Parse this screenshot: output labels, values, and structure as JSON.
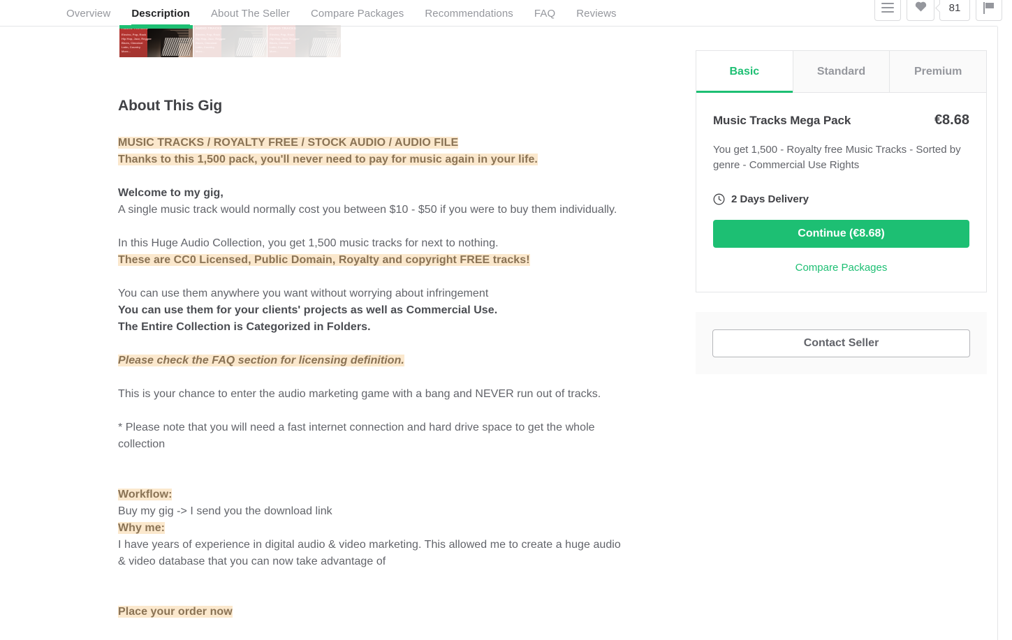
{
  "nav": {
    "items": [
      {
        "label": "Overview",
        "active": false
      },
      {
        "label": "Description",
        "active": true
      },
      {
        "label": "About The Seller",
        "active": false
      },
      {
        "label": "Compare Packages",
        "active": false
      },
      {
        "label": "Recommendations",
        "active": false
      },
      {
        "label": "FAQ",
        "active": false
      },
      {
        "label": "Reviews",
        "active": false
      }
    ],
    "actions": {
      "menu_icon": "list-icon",
      "favorite_icon": "heart-icon",
      "favorite_count": "81",
      "report_icon": "flag-icon"
    }
  },
  "gallery": {
    "thumbs": [
      {
        "badge": "AUDIO TRACKS",
        "lines": "Electro, Pop, Rock\nHip Hop, Jazz, Reggae\nBlues, Classical\nLatin, Country\nMore...",
        "active": true
      },
      {
        "badge": "AUDIO TRACKS",
        "lines": "Electro, Pop, Rock\nHip Hop, Jazz, Reggae\nBlues, Classical\nLatin, Country\nMore...",
        "active": false
      },
      {
        "badge": "AUDIO TRACKS",
        "lines": "Electro, Pop, Rock\nHip Hop, Jazz, Reggae\nBlues, Classical\nLatin, Country\nMore...",
        "active": false
      }
    ]
  },
  "description": {
    "title": "About This Gig",
    "highlight_line_1": "MUSIC TRACKS / ROYALTY FREE / STOCK AUDIO / AUDIO FILE",
    "highlight_line_2": "Thanks to this 1,500 pack, you'll never need to pay for music again in your life.",
    "welcome": "Welcome to my gig,",
    "cost_line": "A single music track would normally cost you between $10 - $50 if you were to buy them individually.",
    "collection_line": "In this Huge Audio Collection, you get 1,500 music tracks for next to nothing.",
    "cc0_line": "These are CC0 Licensed, Public Domain, Royalty and copyright FREE tracks!",
    "use_line_1": "You can use them anywhere you want without worrying about infringement",
    "use_line_2": "You can use them for your clients' projects as well as Commercial Use.",
    "use_line_3": "The Entire Collection is Categorized in Folders.",
    "faq_note": "Please check the FAQ section for licensing definition.",
    "chance_line": "This is your chance to enter the audio marketing game with a bang and NEVER run out of tracks.",
    "note_line": "* Please note that you will need a fast internet connection and hard drive space to get the whole collection",
    "workflow_label": "Workflow:",
    "workflow_line": "Buy my gig  -> I send you the download link",
    "whyme_label": "Why me:",
    "whyme_line": "I have years of experience in digital audio & video marketing. This allowed me to create a huge audio & video database that you can now take advantage of",
    "order_now": "Place your order now"
  },
  "package": {
    "tabs": [
      {
        "label": "Basic",
        "active": true
      },
      {
        "label": "Standard",
        "active": false
      },
      {
        "label": "Premium",
        "active": false
      }
    ],
    "name": "Music Tracks Mega Pack",
    "price": "€8.68",
    "description": "You get 1,500 - Royalty free Music Tracks - Sorted by genre - Commercial Use Rights",
    "delivery_icon": "clock-icon",
    "delivery": "2 Days Delivery",
    "continue_label": "Continue (€8.68)",
    "compare_label": "Compare Packages",
    "contact_label": "Contact Seller"
  },
  "colors": {
    "accent_green": "#1dbf73",
    "highlight_bg": "#fbe8cd",
    "highlight_text": "#8a7355",
    "body_text": "#62646a",
    "heading_text": "#404145"
  }
}
